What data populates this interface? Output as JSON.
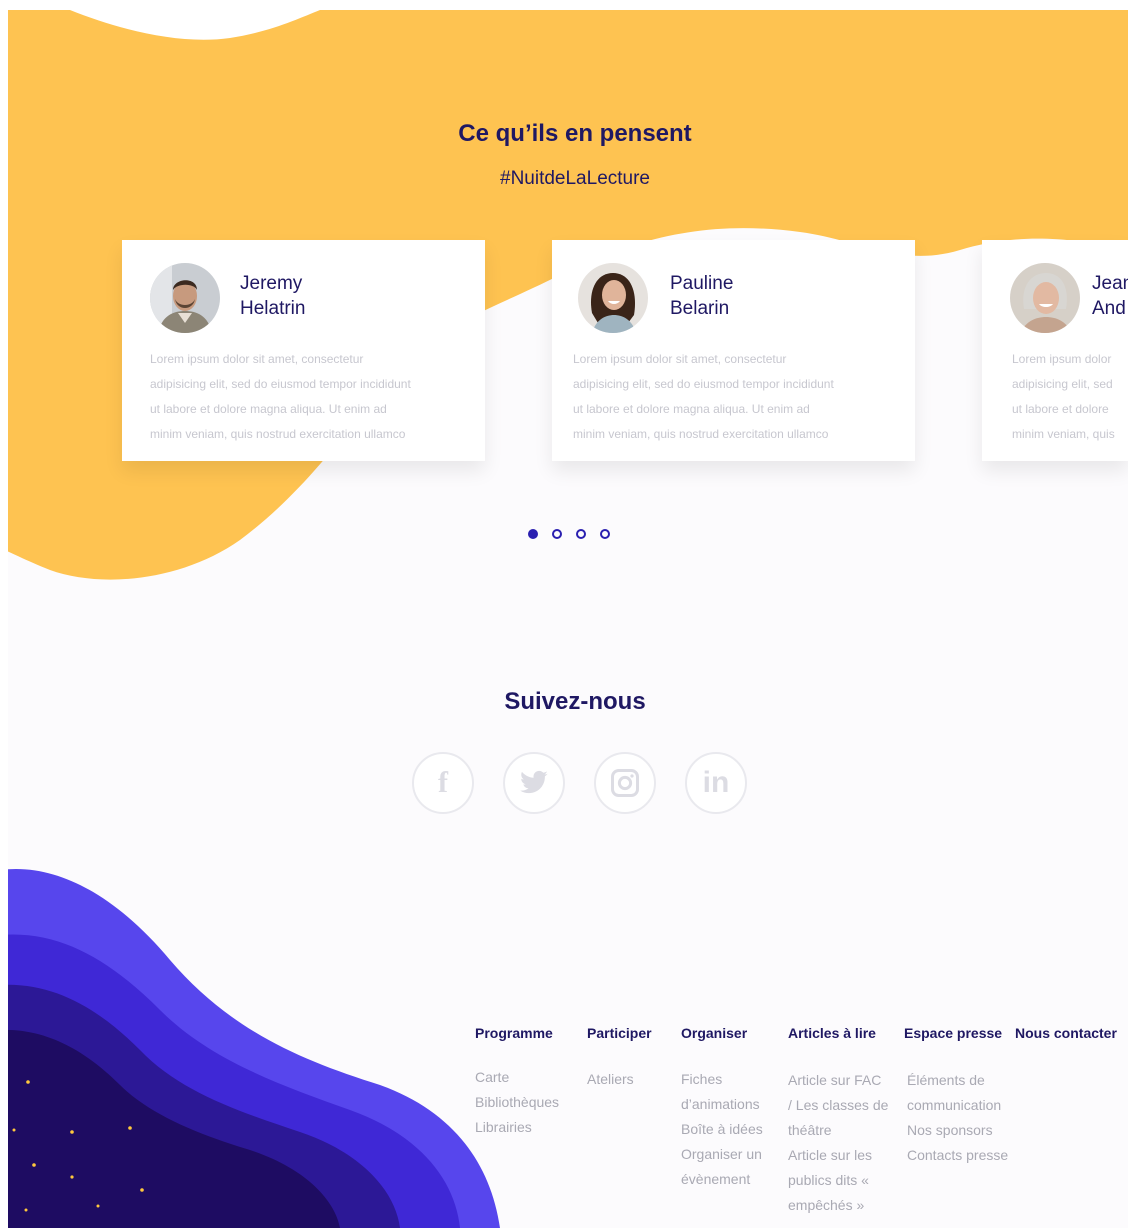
{
  "testimonials_section": {
    "title": "Ce qu’ils en pensent",
    "hashtag": "#NuitdeLaLecture",
    "cards": [
      {
        "name": "Jeremy\nHelatrin",
        "text": "Lorem ipsum dolor sit amet, consectetur\nadipisicing elit, sed do eiusmod tempor incididunt\nut labore et dolore magna aliqua. Ut enim ad\nminim veniam, quis nostrud exercitation ullamco"
      },
      {
        "name": "Pauline\nBelarin",
        "text": "Lorem ipsum dolor sit amet, consectetur\nadipisicing elit, sed do eiusmod tempor incididunt\nut labore et dolore magna aliqua. Ut enim ad\nminim veniam, quis nostrud exercitation ullamco"
      },
      {
        "name": "Jean\nAnd",
        "text": "Lorem ipsum dolor\nadipisicing elit, sed\nut labore et dolore\nminim veniam, quis"
      }
    ],
    "pagination": {
      "count": 4,
      "active": 1
    }
  },
  "follow_section": {
    "title": "Suivez-nous",
    "icons": [
      "facebook-icon",
      "twitter-icon",
      "instagram-icon",
      "linkedin-icon"
    ]
  },
  "footer": {
    "columns": [
      {
        "heading": "Programme",
        "links": [
          "Carte",
          "Bibliothèques",
          "Librairies"
        ]
      },
      {
        "heading": "Participer",
        "links": [
          "Ateliers"
        ]
      },
      {
        "heading": "Organiser",
        "links": [
          "Fiches",
          "d’animations",
          "Boîte à idées",
          "Organiser un",
          "évènement"
        ]
      },
      {
        "heading": "Articles à lire",
        "links": [
          "Article sur FAC",
          "/ Les classes de",
          "théâtre",
          "Article sur les",
          "publics dits «",
          "empêchés »"
        ]
      },
      {
        "heading": "Espace presse",
        "links": [
          "Éléments de",
          "communication",
          "Nos sponsors",
          "Contacts presse"
        ]
      },
      {
        "heading": "Nous contacter",
        "links": []
      }
    ]
  },
  "colors": {
    "yellow": "#fec351",
    "navy": "#1f1863",
    "accent": "#2a1fb0",
    "wave_light": "#5746ed",
    "wave_mid": "#3f28d6",
    "wave_dark": "#2c1896",
    "wave_deep": "#1e0c62"
  }
}
